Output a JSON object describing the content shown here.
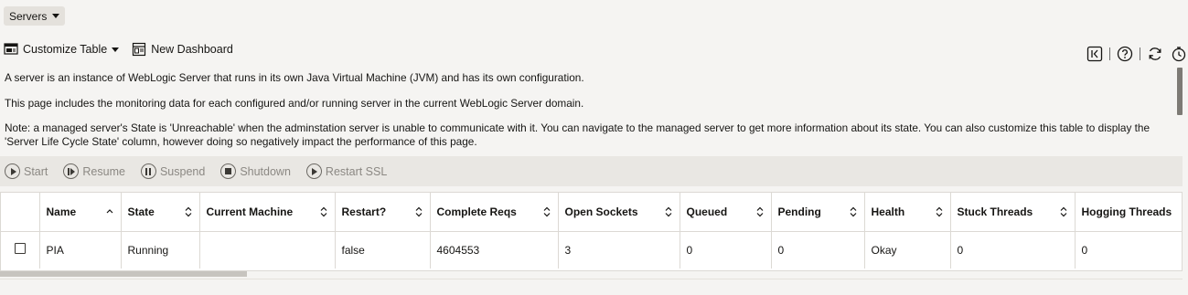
{
  "breadcrumb": {
    "label": "Servers"
  },
  "toolbar": {
    "customize_label": "Customize Table",
    "dashboard_label": "New Dashboard"
  },
  "description": {
    "line1": "A server is an instance of WebLogic Server that runs in its own Java Virtual Machine (JVM) and has its own configuration.",
    "line2": "This page includes the monitoring data for each configured and/or running server in the current WebLogic Server domain.",
    "line3": "Note: a managed server's State is 'Unreachable' when the adminstation server is unable to communicate with it. You can navigate to the managed server to get more information about its state. You can also customize this table to display the 'Server Life Cycle State' column, however doing so negatively impact the performance of this page."
  },
  "actions": {
    "start": "Start",
    "resume": "Resume",
    "suspend": "Suspend",
    "shutdown": "Shutdown",
    "restart_ssl": "Restart SSL"
  },
  "table": {
    "columns": [
      "Name",
      "State",
      "Current Machine",
      "Restart?",
      "Complete Reqs",
      "Open Sockets",
      "Queued",
      "Pending",
      "Health",
      "Stuck Threads",
      "Hogging Threads"
    ],
    "rows": [
      [
        "PIA",
        "Running",
        "",
        "false",
        "4604553",
        "3",
        "0",
        "0",
        "Okay",
        "0",
        "0"
      ]
    ]
  }
}
